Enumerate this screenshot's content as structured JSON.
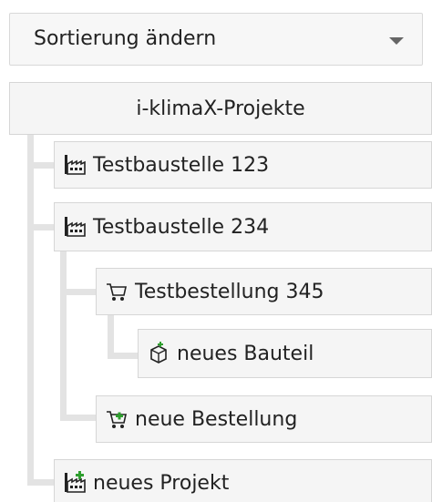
{
  "sort": {
    "label": "Sortierung ändern",
    "caret_icon": "chevron-down-icon"
  },
  "tree": {
    "root_label": "i-klimaX-Projekte",
    "items": [
      {
        "label": "Testbaustelle 123",
        "icon": "factory-icon"
      },
      {
        "label": "Testbaustelle 234",
        "icon": "factory-icon"
      },
      {
        "label": "Testbestellung 345",
        "icon": "cart-icon"
      },
      {
        "label": "neues Bauteil",
        "icon": "add-box-icon"
      },
      {
        "label": "neue Bestellung",
        "icon": "add-cart-icon"
      },
      {
        "label": "neues Projekt",
        "icon": "add-factory-icon"
      }
    ]
  },
  "colors": {
    "add_green": "#2e9e2e",
    "border": "#d6d6d6",
    "connector": "#e3e3e3"
  }
}
